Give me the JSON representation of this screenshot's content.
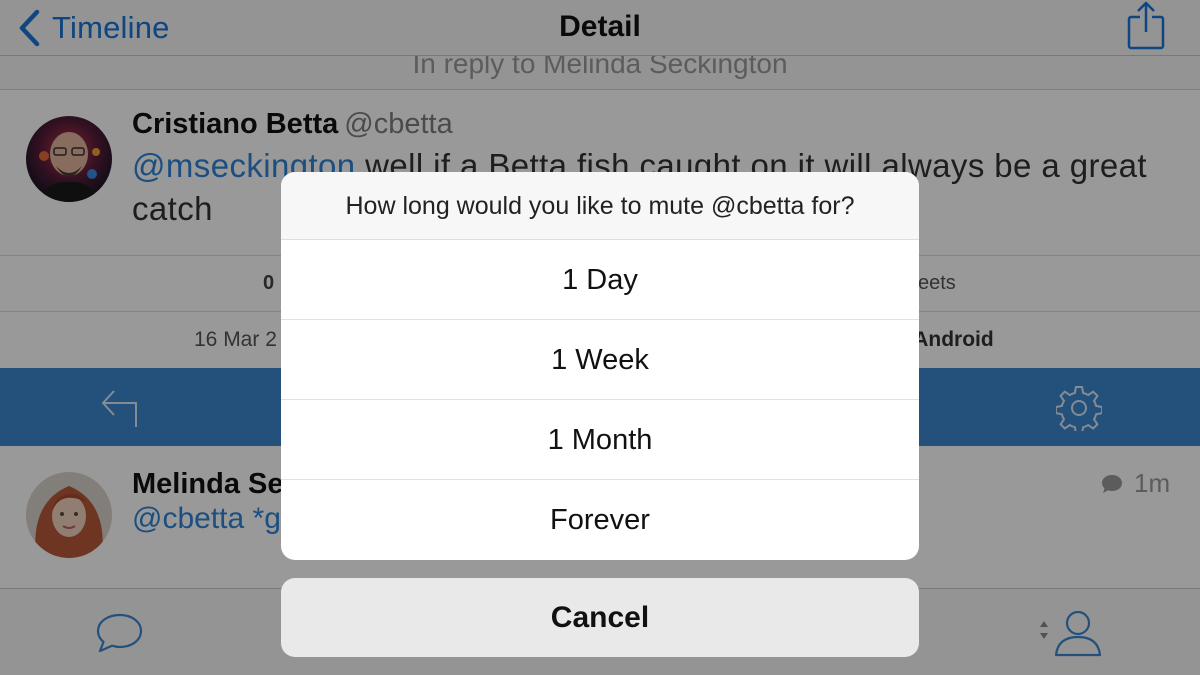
{
  "navbar": {
    "back_label": "Timeline",
    "title": "Detail"
  },
  "reply_context": "In reply to Melinda Seckington",
  "tweet": {
    "author_name": "Cristiano Betta",
    "author_handle": "@cbetta",
    "mention": "@mseckington",
    "text": " well if a Betta fish caught on it will always be a great catch"
  },
  "stats": {
    "count": "0",
    "retweets_label": "eets"
  },
  "meta": {
    "date": "16 Mar 2",
    "client": "r Android"
  },
  "reply": {
    "author_name": "Melinda Se",
    "text": "@cbetta *g",
    "time": "1m"
  },
  "action_sheet": {
    "title": "How long would you like to mute @cbetta for?",
    "options": [
      "1 Day",
      "1 Week",
      "1 Month",
      "Forever"
    ],
    "cancel_label": "Cancel"
  },
  "colors": {
    "accent": "#1a73d6",
    "action_bar": "#3c86cf",
    "mention": "#2f84d6"
  },
  "icons": {
    "back": "chevron-left-icon",
    "share": "share-icon",
    "reply": "reply-arrow-icon",
    "settings": "gear-icon",
    "comment": "speech-bubble-icon",
    "messages": "chat-bubble-icon",
    "account": "profile-icon"
  }
}
